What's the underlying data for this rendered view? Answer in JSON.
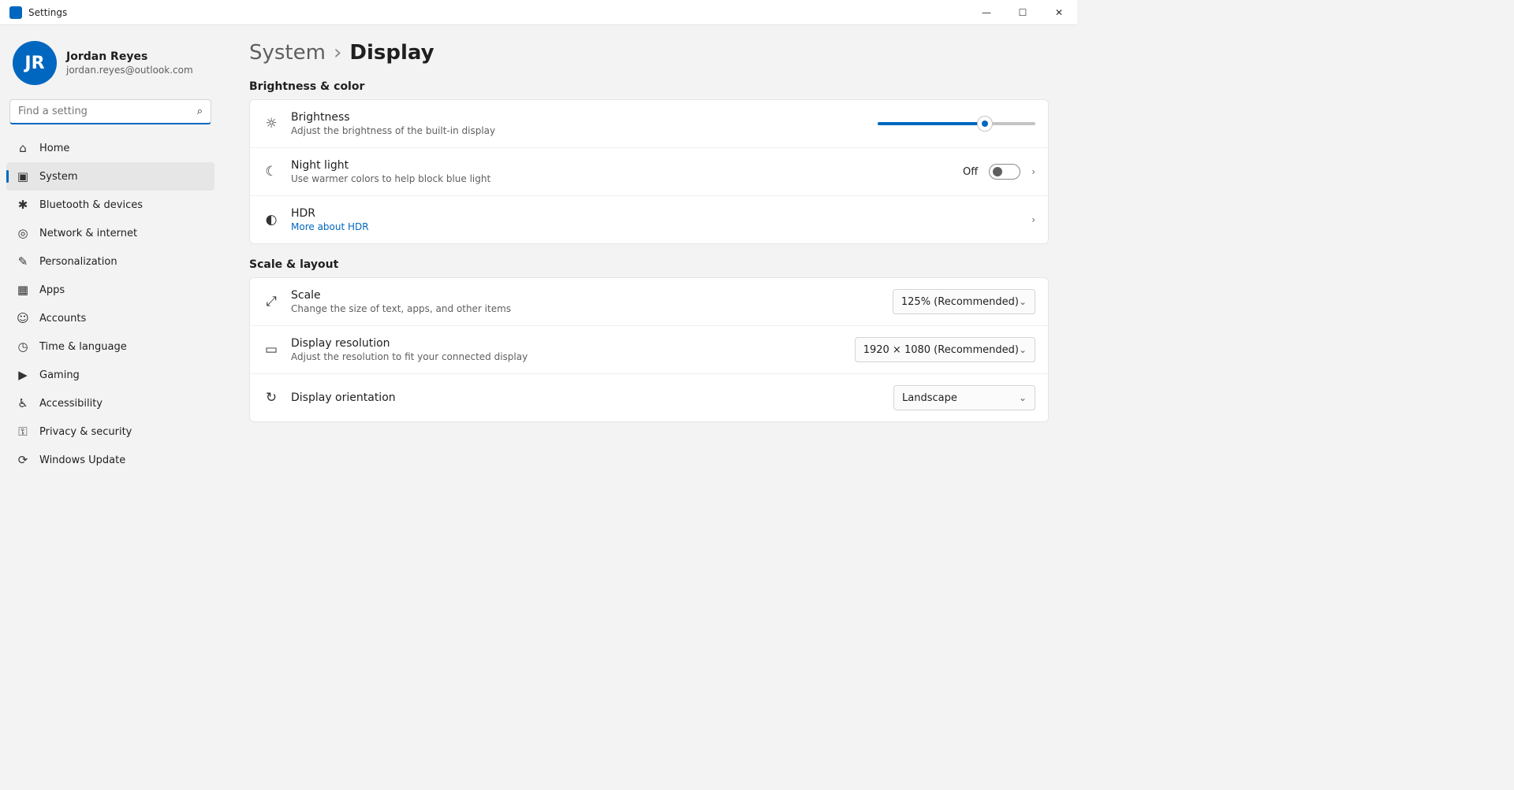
{
  "window": {
    "title": "Settings",
    "minimize": "—",
    "maximize": "☐",
    "close": "✕"
  },
  "profile": {
    "initials": "JR",
    "name": "Jordan Reyes",
    "email": "jordan.reyes@outlook.com"
  },
  "search": {
    "placeholder": "Find a setting"
  },
  "nav": [
    {
      "icon": "⌂",
      "label": "Home"
    },
    {
      "icon": "▣",
      "label": "System"
    },
    {
      "icon": "✱",
      "label": "Bluetooth & devices"
    },
    {
      "icon": "◎",
      "label": "Network & internet"
    },
    {
      "icon": "✎",
      "label": "Personalization"
    },
    {
      "icon": "▦",
      "label": "Apps"
    },
    {
      "icon": "☺",
      "label": "Accounts"
    },
    {
      "icon": "◷",
      "label": "Time & language"
    },
    {
      "icon": "▶",
      "label": "Gaming"
    },
    {
      "icon": "♿",
      "label": "Accessibility"
    },
    {
      "icon": "⚿",
      "label": "Privacy & security"
    },
    {
      "icon": "⟳",
      "label": "Windows Update"
    }
  ],
  "breadcrumb": {
    "parent": "System",
    "sep": "›",
    "current": "Display"
  },
  "brightness": {
    "section": "Brightness & color",
    "title": "Brightness",
    "desc": "Adjust the brightness of the built-in display",
    "level": 0.68,
    "night_title": "Night light",
    "night_desc": "Use warmer colors to help block blue light",
    "night_state": "Off",
    "hdr_title": "HDR",
    "hdr_desc": "More about HDR"
  },
  "layout": {
    "section": "Scale & layout",
    "scale_title": "Scale",
    "scale_desc": "Change the size of text, apps, and other items",
    "scale_value": "125% (Recommended)",
    "res_title": "Display resolution",
    "res_desc": "Adjust the resolution to fit your connected display",
    "res_value": "1920 × 1080 (Recommended)",
    "orient_title": "Display orientation",
    "orient_value": "Landscape"
  },
  "colors": {
    "accent": "#0067c0"
  }
}
